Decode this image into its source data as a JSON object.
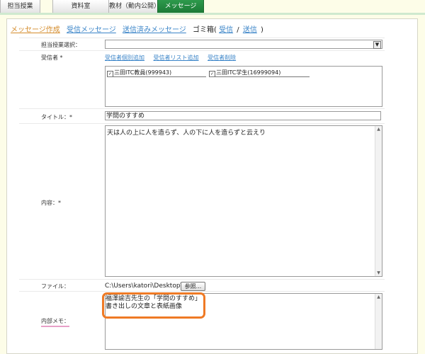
{
  "tabs": [
    "担当授業",
    "資料室",
    "教材（動内公開）",
    "メッセージ"
  ],
  "submenu": {
    "compose": "メッセージ作成",
    "received": "受信メッセージ",
    "sent": "送信済みメッセージ",
    "trash_prefix": "ゴミ箱(",
    "trash_received": "受信",
    "trash_sep": "/",
    "trash_sent": "送信",
    "trash_suffix": ")"
  },
  "form": {
    "course_select_label": "担当授業選択：",
    "recipients_label": "受信者 *",
    "recipient_links": [
      "受信者個別追加",
      "受信者リスト追加",
      "受信者削除"
    ],
    "recipients": [
      "三田ITC教員(999943)",
      "三田ITC学生(16999094)"
    ],
    "title_label": "タイトル：*",
    "title_value": "学問のすすめ",
    "body_label": "内容：*",
    "body_value": "天は人の上に人を造らず、人の下に人を造らずと云えり",
    "file_label": "ファイル：",
    "file_path": "C:\\Users\\katori\\Desktop\\",
    "browse_label": "参照...",
    "memo_label": "内部メモ：",
    "memo_lines": [
      "福澤諭吉先生の「学問のすすめ」",
      "書き出しの文章と表紙画像"
    ]
  },
  "colors": {
    "active_tab": "#1c7a36",
    "link": "#3a84c8",
    "current_link": "#d48b2a",
    "highlight": "#ef7a25"
  },
  "icons": {
    "dropdown": "chevron-down-icon",
    "checkbox": "checkbox-checked-icon"
  }
}
